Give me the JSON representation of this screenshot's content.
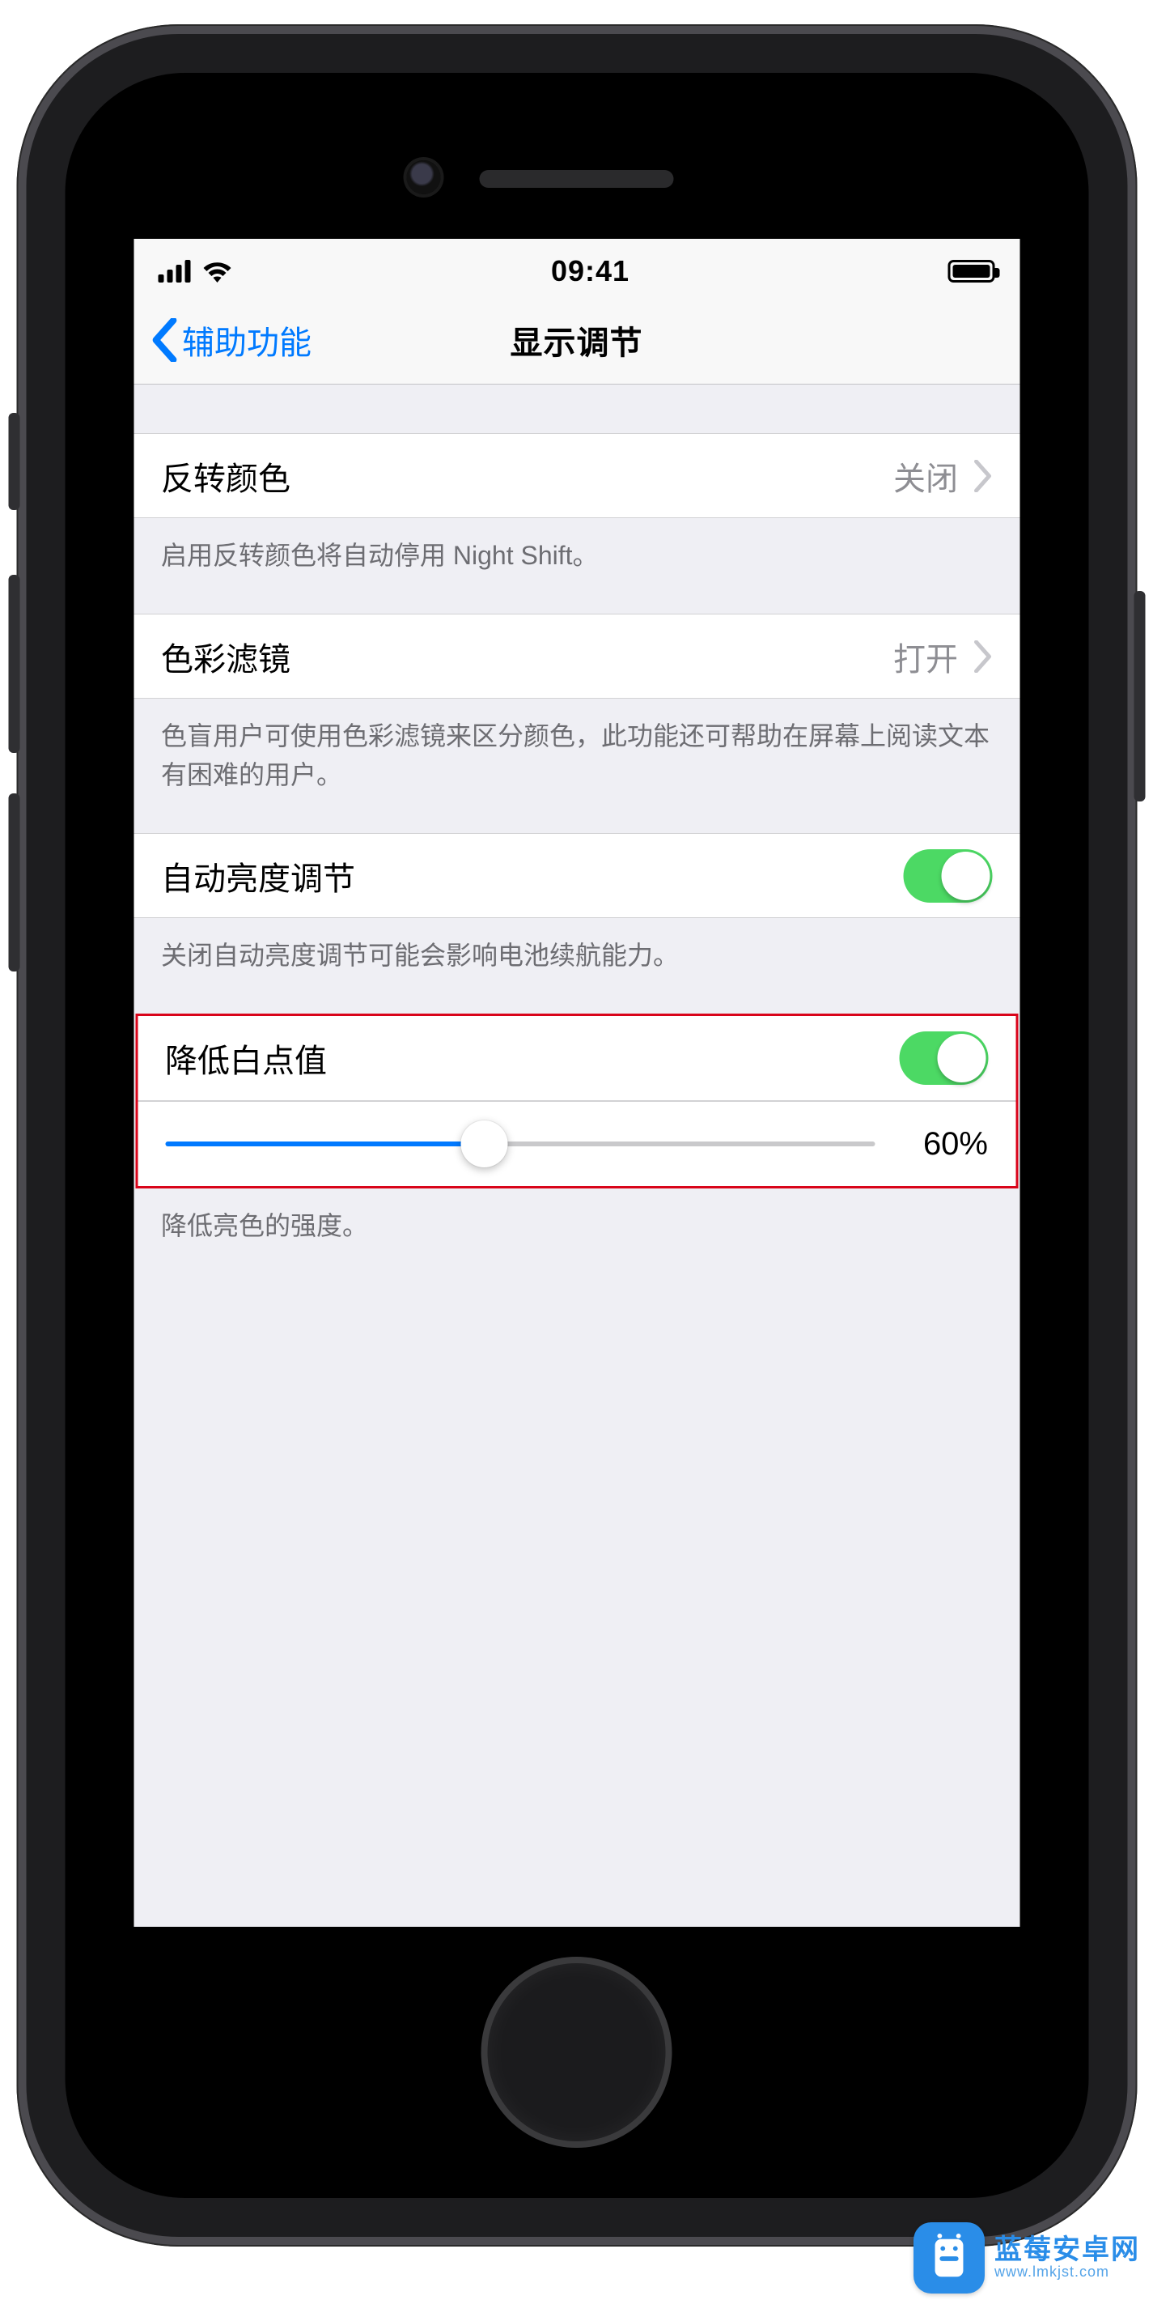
{
  "statusbar": {
    "time": "09:41"
  },
  "nav": {
    "back_label": "辅助功能",
    "title": "显示调节"
  },
  "rows": {
    "invert": {
      "label": "反转颜色",
      "value": "关闭"
    },
    "invert_footer": "启用反转颜色将自动停用 Night Shift。",
    "color_filter": {
      "label": "色彩滤镜",
      "value": "打开"
    },
    "color_filter_footer": "色盲用户可使用色彩滤镜来区分颜色，此功能还可帮助在屏幕上阅读文本有困难的用户。",
    "auto_brightness": {
      "label": "自动亮度调节",
      "on": true
    },
    "auto_brightness_footer": "关闭自动亮度调节可能会影响电池续航能力。",
    "reduce_white": {
      "label": "降低白点值",
      "on": true
    },
    "slider": {
      "percent": 60,
      "display": "60%",
      "fill_pct": 45
    },
    "reduce_white_footer": "降低亮色的强度。"
  },
  "watermark": {
    "brand": "蓝莓安卓网",
    "domain": "www.lmkjst.com"
  }
}
